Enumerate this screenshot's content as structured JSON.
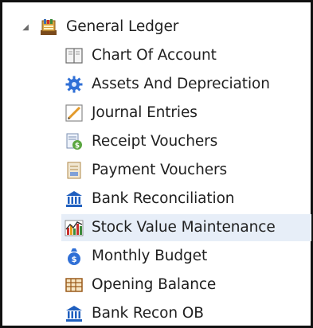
{
  "tree": {
    "root": {
      "label": "General Ledger",
      "icon": "ledger-icon"
    },
    "items": [
      {
        "label": "Chart Of Account",
        "icon": "book-icon"
      },
      {
        "label": "Assets And Depreciation",
        "icon": "gear-icon"
      },
      {
        "label": "Journal Entries",
        "icon": "pencil-icon"
      },
      {
        "label": "Receipt Vouchers",
        "icon": "receipt-icon"
      },
      {
        "label": "Payment Vouchers",
        "icon": "payment-voucher-icon"
      },
      {
        "label": "Bank Reconciliation",
        "icon": "bank-icon"
      },
      {
        "label": "Stock Value Maintenance",
        "icon": "stock-chart-icon",
        "selected": true
      },
      {
        "label": "Monthly Budget",
        "icon": "money-bag-icon"
      },
      {
        "label": "Opening Balance",
        "icon": "abacus-icon"
      },
      {
        "label": "Bank Recon OB",
        "icon": "bank-icon"
      }
    ]
  },
  "colors": {
    "selection": "#e7eef8",
    "text": "#1f1f1f",
    "frame": "#111111"
  }
}
